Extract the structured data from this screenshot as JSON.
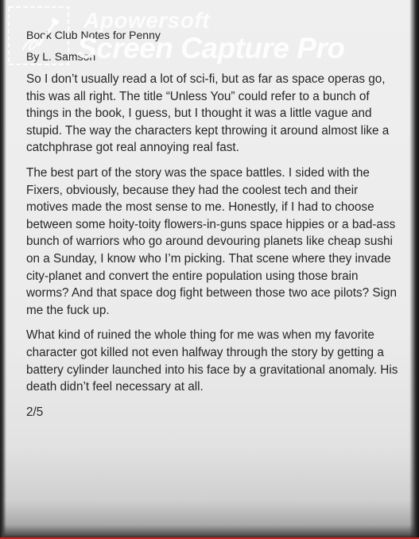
{
  "document": {
    "title": "Book Club Notes for Penny",
    "author": "By L. Samson",
    "paragraphs": [
      "So I don’t usually read a lot of sci-fi, but as far as space operas go, this was all right. The title “Unless You” could refer to a bunch of things in the book, I guess, but I thought it was a little vague and stupid. The way the characters kept throwing it around almost like a catchphrase got real annoying real fast.",
      "The best part of the story was the space battles. I sided with the Fixers, obviously, because they had the coolest tech and their motives made the most sense to me. Honestly, if I had to choose between some hoity-toity flowers-in-guns space hippies or a bad-ass bunch of warriors who go around devouring planets like cheap sushi on a Sunday, I know who I’m picking. That scene where they invade city-planet and convert the entire population using those brain worms? And that space dog fight between those two ace pilots? Sign me the fuck up.",
      "What kind of ruined the whole thing for me was when my favorite character got killed not even halfway through the story by getting a battery cylinder launched into his face by a gravitational anomaly. His death didn’t feel necessary at all."
    ],
    "page_indicator": "2/5"
  },
  "watermark": {
    "line1": "Apowersoft",
    "line2": "Screen Capture Pro",
    "logo_icon": "pen-in-frame-icon"
  },
  "colors": {
    "text": "#262626",
    "paper": "#efefef",
    "bottom_line": "#c8231f"
  }
}
